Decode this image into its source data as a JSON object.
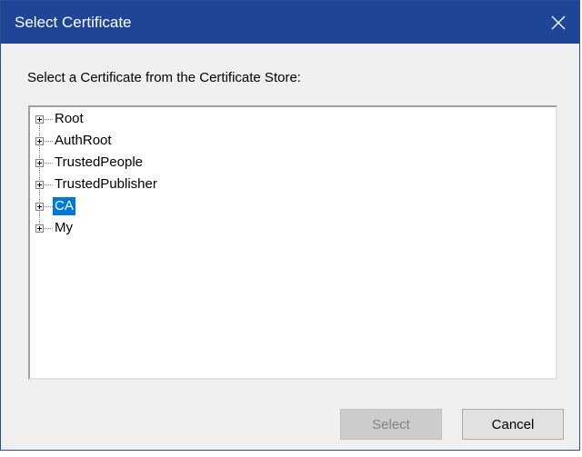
{
  "window": {
    "title": "Select Certificate",
    "close_icon": "close-icon"
  },
  "prompt": "Select a Certificate from the Certificate Store:",
  "tree": {
    "items": [
      {
        "label": "Root",
        "selected": false
      },
      {
        "label": "AuthRoot",
        "selected": false
      },
      {
        "label": "TrustedPeople",
        "selected": false
      },
      {
        "label": "TrustedPublisher",
        "selected": false
      },
      {
        "label": "CA",
        "selected": true
      },
      {
        "label": "My",
        "selected": false
      }
    ]
  },
  "buttons": {
    "select_label": "Select",
    "select_enabled": false,
    "cancel_label": "Cancel"
  },
  "colors": {
    "titlebar": "#1f4596",
    "selection": "#0078d7"
  }
}
